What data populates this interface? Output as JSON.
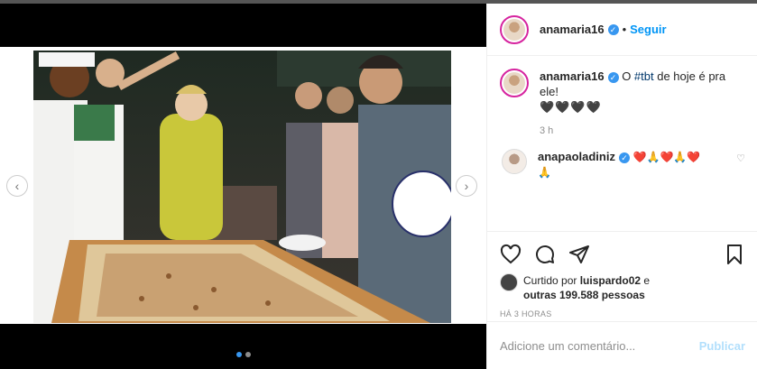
{
  "post": {
    "author": "anamaria16",
    "follow_label": "Seguir",
    "separator": "•",
    "carousel": {
      "total": 2,
      "current": 1
    }
  },
  "caption": {
    "author": "anamaria16",
    "text_before": "O ",
    "hashtag": "#tbt",
    "text_after": " de hoje é pra ele!",
    "hearts": "🖤🖤🖤🖤",
    "time": "3 h"
  },
  "comment": {
    "author": "anapaoladiniz",
    "text": "❤️🙏❤️🙏❤️",
    "text2": "🙏"
  },
  "likes": {
    "prefix": "Curtido por ",
    "user": "luispardo02",
    "connector": " e",
    "others": "outras 199.588 pessoas"
  },
  "timestamp": "HÁ 3 HORAS",
  "composer": {
    "placeholder": "Adicione um comentário...",
    "publish_label": "Publicar"
  },
  "icons": {
    "prev": "chevron-left-icon",
    "next": "chevron-right-icon",
    "like": "heart-icon",
    "comment": "comment-icon",
    "share": "share-icon",
    "save": "bookmark-icon",
    "verified": "verified-badge-icon"
  },
  "colors": {
    "accent": "#0095f6",
    "verified": "#3897f0",
    "publish_disabled": "#b2dffc"
  }
}
